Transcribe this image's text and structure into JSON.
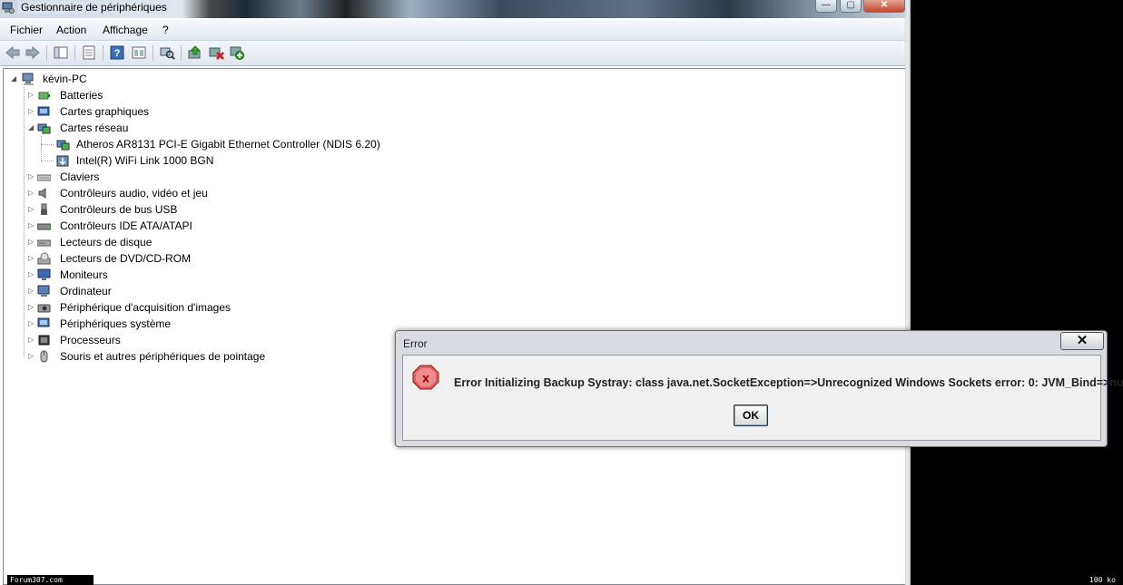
{
  "window": {
    "title": "Gestionnaire de périphériques",
    "caption_close": "✕",
    "caption_min": "—",
    "caption_max": "▢"
  },
  "menu": [
    "Fichier",
    "Action",
    "Affichage",
    "?"
  ],
  "toolbar_icons": [
    "back-arrow-icon",
    "forward-arrow-icon",
    "show-hide-tree-icon",
    "properties-icon",
    "help-icon",
    "view-icon",
    "scan-hardware-icon",
    "update-driver-icon",
    "uninstall-icon",
    "enable-device-icon"
  ],
  "tree": {
    "root": "kévin-PC",
    "categories": [
      {
        "label": "Batteries",
        "icon": "battery-icon",
        "expanded": false
      },
      {
        "label": "Cartes graphiques",
        "icon": "display-adapter-icon",
        "expanded": false
      },
      {
        "label": "Cartes réseau",
        "icon": "network-adapter-icon",
        "expanded": true,
        "children": [
          {
            "label": "Atheros AR8131 PCI-E Gigabit Ethernet Controller (NDIS 6.20)",
            "icon": "network-card-icon"
          },
          {
            "label": "Intel(R) WiFi Link 1000 BGN",
            "icon": "wifi-card-icon"
          }
        ]
      },
      {
        "label": "Claviers",
        "icon": "keyboard-icon",
        "expanded": false
      },
      {
        "label": "Contrôleurs audio, vidéo et jeu",
        "icon": "speaker-icon",
        "expanded": false
      },
      {
        "label": "Contrôleurs de bus USB",
        "icon": "usb-icon",
        "expanded": false
      },
      {
        "label": "Contrôleurs IDE ATA/ATAPI",
        "icon": "ide-controller-icon",
        "expanded": false
      },
      {
        "label": "Lecteurs de disque",
        "icon": "disk-drive-icon",
        "expanded": false
      },
      {
        "label": "Lecteurs de DVD/CD-ROM",
        "icon": "dvd-drive-icon",
        "expanded": false
      },
      {
        "label": "Moniteurs",
        "icon": "monitor-icon",
        "expanded": false
      },
      {
        "label": "Ordinateur",
        "icon": "computer-icon",
        "expanded": false
      },
      {
        "label": "Périphérique d'acquisition d'images",
        "icon": "camera-icon",
        "expanded": false
      },
      {
        "label": "Périphériques système",
        "icon": "system-device-icon",
        "expanded": false
      },
      {
        "label": "Processeurs",
        "icon": "processor-icon",
        "expanded": false
      },
      {
        "label": "Souris et autres périphériques de pointage",
        "icon": "mouse-icon",
        "expanded": false
      }
    ]
  },
  "dialog": {
    "title": "Error",
    "close_glyph": "✕",
    "message": "Error Initializing Backup Systray: class java.net.SocketException=>Unrecognized Windows Sockets error: 0: JVM_Bind=>null",
    "ok_label": "OK",
    "icon_glyph": "x"
  },
  "watermarks": {
    "left": "Forum307.com",
    "right": "100 ko"
  }
}
